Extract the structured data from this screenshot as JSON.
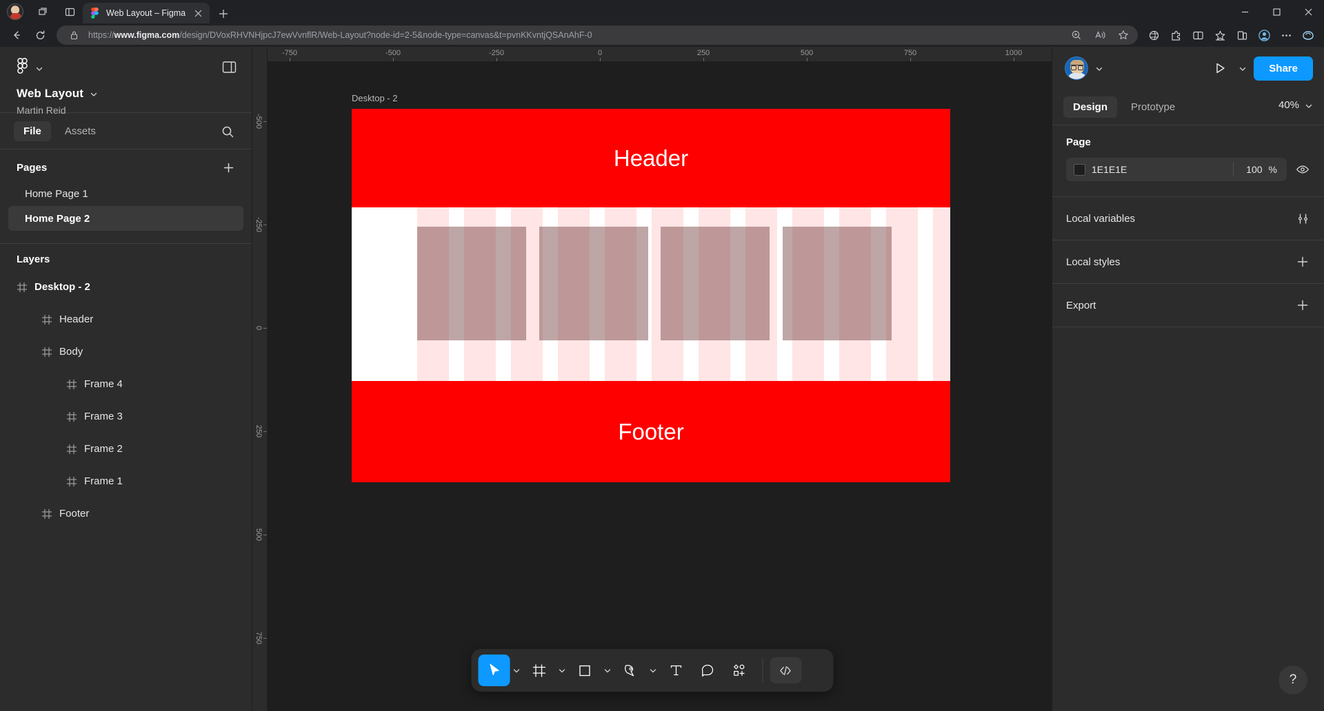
{
  "browser": {
    "tab": {
      "title": "Web Layout – Figma",
      "icon": "figma-icon",
      "close": "×"
    },
    "new_tab": "+",
    "url_prefix": "https://",
    "url_bold": "www.figma.com",
    "url_rest": "/design/DVoxRHVNHjpcJ7ewVvnflR/Web-Layout?node-id=2-5&node-type=canvas&t=pvnKKvntjQSAnAhF-0",
    "nav": {
      "back": "back-arrow",
      "refresh": "refresh"
    },
    "toolbar_icons": [
      "zoom-icon",
      "read-aloud-icon",
      "favorite-icon",
      "browser-essentials-icon",
      "extensions-icon",
      "split-screen-icon",
      "collections-icon",
      "favorites-bar-icon",
      "settings-icon",
      "more-icon",
      "copilot-icon"
    ],
    "window_controls": {
      "minimize": "–",
      "maximize": "□",
      "close": "✕"
    }
  },
  "left_panel": {
    "file_name": "Web Layout",
    "owner": "Martin Reid",
    "tabs": [
      {
        "label": "File",
        "active": true
      },
      {
        "label": "Assets",
        "active": false
      }
    ],
    "search_icon": "search-icon",
    "panel_toggle_icon": "panel-toggle-icon",
    "pages": {
      "title": "Pages",
      "add_icon": "plus-icon",
      "items": [
        {
          "label": "Home Page 1",
          "selected": false
        },
        {
          "label": "Home Page 2",
          "selected": true
        }
      ]
    },
    "layers": {
      "title": "Layers",
      "items": [
        {
          "label": "Desktop - 2",
          "depth": 0
        },
        {
          "label": "Header",
          "depth": 1
        },
        {
          "label": "Body",
          "depth": 1
        },
        {
          "label": "Frame 4",
          "depth": 2
        },
        {
          "label": "Frame 3",
          "depth": 2
        },
        {
          "label": "Frame 2",
          "depth": 2
        },
        {
          "label": "Frame 1",
          "depth": 2
        },
        {
          "label": "Footer",
          "depth": 1
        }
      ]
    }
  },
  "canvas": {
    "frame_label": "Desktop - 2",
    "ruler_h": [
      "-750",
      "-500",
      "-250",
      "0",
      "250",
      "500",
      "750",
      "1000"
    ],
    "ruler_v": [
      "-500",
      "-250",
      "0",
      "250",
      "500",
      "750"
    ],
    "artboard": {
      "header_text": "Header",
      "footer_text": "Footer",
      "bg_color": "#FFFFFF",
      "accent_color": "#FF0000"
    }
  },
  "toolbar": {
    "tools": [
      {
        "name": "move-tool",
        "icon": "cursor-icon",
        "active": true,
        "chevron": true
      },
      {
        "name": "frame-tool",
        "icon": "frame-icon",
        "active": false,
        "chevron": true
      },
      {
        "name": "shape-tool",
        "icon": "square-icon",
        "active": false,
        "chevron": true
      },
      {
        "name": "pen-tool",
        "icon": "pen-icon",
        "active": false,
        "chevron": true
      },
      {
        "name": "text-tool",
        "icon": "text-icon",
        "active": false,
        "chevron": false
      },
      {
        "name": "comment-tool",
        "icon": "comment-icon",
        "active": false,
        "chevron": false
      },
      {
        "name": "actions-tool",
        "icon": "plugins-icon",
        "active": false,
        "chevron": false
      }
    ],
    "dev_mode": {
      "name": "dev-mode-toggle",
      "icon": "code-icon"
    }
  },
  "right_panel": {
    "share_label": "Share",
    "present_icon": "play-icon",
    "tabs": [
      {
        "label": "Design",
        "active": true
      },
      {
        "label": "Prototype",
        "active": false
      }
    ],
    "zoom": "40%",
    "page_section": {
      "title": "Page",
      "color_hex": "1E1E1E",
      "opacity": "100",
      "opacity_unit": "%",
      "visibility_icon": "eye-icon"
    },
    "rows": [
      {
        "label": "Local variables",
        "icon": "sliders-icon"
      },
      {
        "label": "Local styles",
        "icon": "plus-icon"
      },
      {
        "label": "Export",
        "icon": "plus-icon"
      }
    ],
    "help_label": "?"
  }
}
